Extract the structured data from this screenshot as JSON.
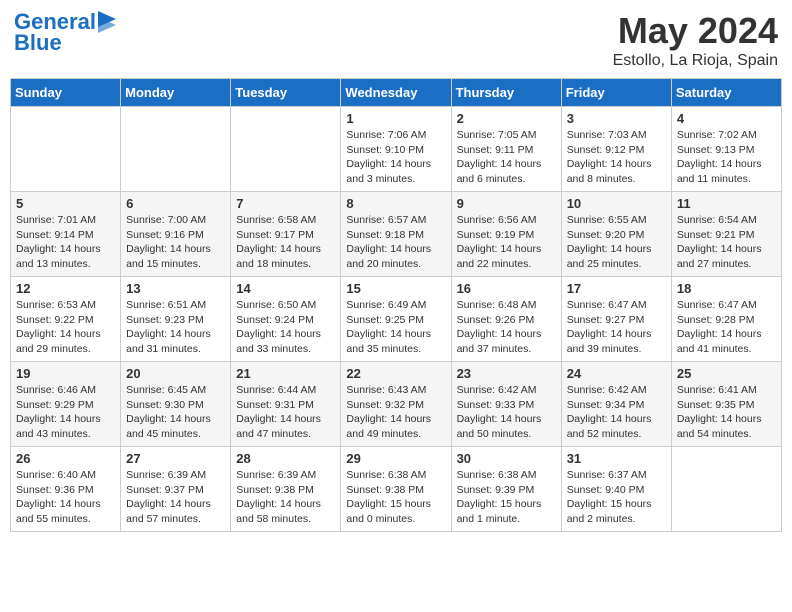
{
  "header": {
    "logo_line1": "General",
    "logo_line2": "Blue",
    "month": "May 2024",
    "location": "Estollo, La Rioja, Spain"
  },
  "weekdays": [
    "Sunday",
    "Monday",
    "Tuesday",
    "Wednesday",
    "Thursday",
    "Friday",
    "Saturday"
  ],
  "weeks": [
    [
      {
        "day": "",
        "info": ""
      },
      {
        "day": "",
        "info": ""
      },
      {
        "day": "",
        "info": ""
      },
      {
        "day": "1",
        "info": "Sunrise: 7:06 AM\nSunset: 9:10 PM\nDaylight: 14 hours\nand 3 minutes."
      },
      {
        "day": "2",
        "info": "Sunrise: 7:05 AM\nSunset: 9:11 PM\nDaylight: 14 hours\nand 6 minutes."
      },
      {
        "day": "3",
        "info": "Sunrise: 7:03 AM\nSunset: 9:12 PM\nDaylight: 14 hours\nand 8 minutes."
      },
      {
        "day": "4",
        "info": "Sunrise: 7:02 AM\nSunset: 9:13 PM\nDaylight: 14 hours\nand 11 minutes."
      }
    ],
    [
      {
        "day": "5",
        "info": "Sunrise: 7:01 AM\nSunset: 9:14 PM\nDaylight: 14 hours\nand 13 minutes."
      },
      {
        "day": "6",
        "info": "Sunrise: 7:00 AM\nSunset: 9:16 PM\nDaylight: 14 hours\nand 15 minutes."
      },
      {
        "day": "7",
        "info": "Sunrise: 6:58 AM\nSunset: 9:17 PM\nDaylight: 14 hours\nand 18 minutes."
      },
      {
        "day": "8",
        "info": "Sunrise: 6:57 AM\nSunset: 9:18 PM\nDaylight: 14 hours\nand 20 minutes."
      },
      {
        "day": "9",
        "info": "Sunrise: 6:56 AM\nSunset: 9:19 PM\nDaylight: 14 hours\nand 22 minutes."
      },
      {
        "day": "10",
        "info": "Sunrise: 6:55 AM\nSunset: 9:20 PM\nDaylight: 14 hours\nand 25 minutes."
      },
      {
        "day": "11",
        "info": "Sunrise: 6:54 AM\nSunset: 9:21 PM\nDaylight: 14 hours\nand 27 minutes."
      }
    ],
    [
      {
        "day": "12",
        "info": "Sunrise: 6:53 AM\nSunset: 9:22 PM\nDaylight: 14 hours\nand 29 minutes."
      },
      {
        "day": "13",
        "info": "Sunrise: 6:51 AM\nSunset: 9:23 PM\nDaylight: 14 hours\nand 31 minutes."
      },
      {
        "day": "14",
        "info": "Sunrise: 6:50 AM\nSunset: 9:24 PM\nDaylight: 14 hours\nand 33 minutes."
      },
      {
        "day": "15",
        "info": "Sunrise: 6:49 AM\nSunset: 9:25 PM\nDaylight: 14 hours\nand 35 minutes."
      },
      {
        "day": "16",
        "info": "Sunrise: 6:48 AM\nSunset: 9:26 PM\nDaylight: 14 hours\nand 37 minutes."
      },
      {
        "day": "17",
        "info": "Sunrise: 6:47 AM\nSunset: 9:27 PM\nDaylight: 14 hours\nand 39 minutes."
      },
      {
        "day": "18",
        "info": "Sunrise: 6:47 AM\nSunset: 9:28 PM\nDaylight: 14 hours\nand 41 minutes."
      }
    ],
    [
      {
        "day": "19",
        "info": "Sunrise: 6:46 AM\nSunset: 9:29 PM\nDaylight: 14 hours\nand 43 minutes."
      },
      {
        "day": "20",
        "info": "Sunrise: 6:45 AM\nSunset: 9:30 PM\nDaylight: 14 hours\nand 45 minutes."
      },
      {
        "day": "21",
        "info": "Sunrise: 6:44 AM\nSunset: 9:31 PM\nDaylight: 14 hours\nand 47 minutes."
      },
      {
        "day": "22",
        "info": "Sunrise: 6:43 AM\nSunset: 9:32 PM\nDaylight: 14 hours\nand 49 minutes."
      },
      {
        "day": "23",
        "info": "Sunrise: 6:42 AM\nSunset: 9:33 PM\nDaylight: 14 hours\nand 50 minutes."
      },
      {
        "day": "24",
        "info": "Sunrise: 6:42 AM\nSunset: 9:34 PM\nDaylight: 14 hours\nand 52 minutes."
      },
      {
        "day": "25",
        "info": "Sunrise: 6:41 AM\nSunset: 9:35 PM\nDaylight: 14 hours\nand 54 minutes."
      }
    ],
    [
      {
        "day": "26",
        "info": "Sunrise: 6:40 AM\nSunset: 9:36 PM\nDaylight: 14 hours\nand 55 minutes."
      },
      {
        "day": "27",
        "info": "Sunrise: 6:39 AM\nSunset: 9:37 PM\nDaylight: 14 hours\nand 57 minutes."
      },
      {
        "day": "28",
        "info": "Sunrise: 6:39 AM\nSunset: 9:38 PM\nDaylight: 14 hours\nand 58 minutes."
      },
      {
        "day": "29",
        "info": "Sunrise: 6:38 AM\nSunset: 9:38 PM\nDaylight: 15 hours\nand 0 minutes."
      },
      {
        "day": "30",
        "info": "Sunrise: 6:38 AM\nSunset: 9:39 PM\nDaylight: 15 hours\nand 1 minute."
      },
      {
        "day": "31",
        "info": "Sunrise: 6:37 AM\nSunset: 9:40 PM\nDaylight: 15 hours\nand 2 minutes."
      },
      {
        "day": "",
        "info": ""
      }
    ]
  ]
}
